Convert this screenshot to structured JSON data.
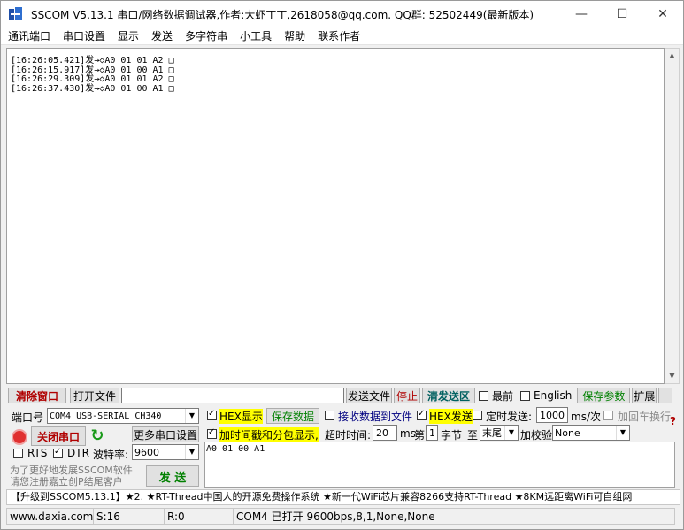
{
  "window": {
    "title": "SSCOM V5.13.1 串口/网络数据调试器,作者:大虾丁丁,2618058@qq.com. QQ群: 52502449(最新版本)",
    "minimize": "—",
    "maximize": "☐",
    "close": "✕"
  },
  "menu": [
    "通讯端口",
    "串口设置",
    "显示",
    "发送",
    "多字符串",
    "小工具",
    "帮助",
    "联系作者"
  ],
  "output_lines": [
    "[16:26:05.421]发→◇A0 01 01 A2 □",
    "[16:26:15.917]发→◇A0 01 00 A1 □",
    "[16:26:29.309]发→◇A0 01 01 A2 □",
    "[16:26:37.430]发→◇A0 01 00 A1 □"
  ],
  "toolbar": {
    "clear_window": "清除窗口",
    "open_file": "打开文件",
    "file_path": "",
    "send_file": "发送文件",
    "stop": "停止",
    "clear_send": "清发送区",
    "topmost": "最前",
    "english": "English",
    "save_params": "保存参数",
    "expand": "扩展",
    "collapse": "—"
  },
  "port": {
    "port_label": "端口号",
    "port_value": "COM4 USB-SERIAL CH340",
    "close_port": "关闭串口",
    "more_settings": "更多串口设置",
    "rts": "RTS",
    "dtr": "DTR",
    "baud_label": "波特率:",
    "baud_value": "9600"
  },
  "options": {
    "hex_display": "HEX显示",
    "save_data": "保存数据",
    "recv_to_file": "接收数据到文件",
    "hex_send": "HEX发送",
    "timed_send": "定时发送:",
    "interval": "1000",
    "interval_unit": "ms/次",
    "add_crlf": "加回车换行",
    "timestamp": "加时间戳和分包显示,",
    "timeout_label": "超时时间:",
    "timeout": "20",
    "timeout_unit": "ms",
    "nth_label": "第",
    "nth": "1",
    "byte_label": "字节",
    "to_label": "至",
    "to_value": "末尾",
    "checksum_label": "加校验",
    "checksum_value": "None",
    "question": "?"
  },
  "send": {
    "text": "A0 01 00 A1",
    "button": "发  送",
    "hint": "为了更好地发展SSCOM软件\n请您注册嘉立创P结尾客户"
  },
  "promo": "【升级到SSCOM5.13.1】★2. ★RT-Thread中国人的开源免费操作系统 ★新一代WiFi芯片兼容8266支持RT-Thread ★8KM远距离WiFi可自组网",
  "status": {
    "site": "www.daxia.com",
    "sent": "S:16",
    "recv": "R:0",
    "port_state": "COM4 已打开  9600bps,8,1,None,None"
  }
}
